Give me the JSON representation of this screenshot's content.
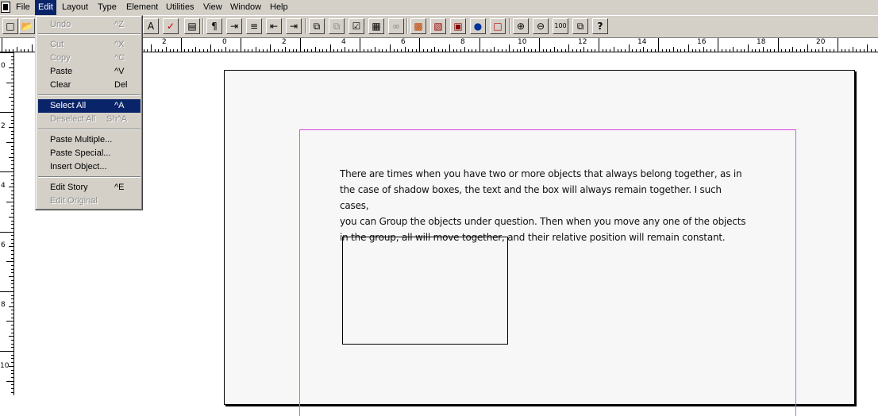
{
  "menubar": {
    "items": [
      {
        "label": "File"
      },
      {
        "label": "Edit"
      },
      {
        "label": "Layout"
      },
      {
        "label": "Type"
      },
      {
        "label": "Element"
      },
      {
        "label": "Utilities"
      },
      {
        "label": "View"
      },
      {
        "label": "Window"
      },
      {
        "label": "Help"
      }
    ]
  },
  "edit_menu": {
    "undo": {
      "label": "Undo",
      "shortcut": "^Z"
    },
    "cut": {
      "label": "Cut",
      "shortcut": "^X"
    },
    "copy": {
      "label": "Copy",
      "shortcut": "^C"
    },
    "paste": {
      "label": "Paste",
      "shortcut": "^V"
    },
    "clear": {
      "label": "Clear",
      "shortcut": "Del"
    },
    "select_all": {
      "label": "Select All",
      "shortcut": "^A"
    },
    "deselect_all": {
      "label": "Deselect All",
      "shortcut": "Sh^A"
    },
    "paste_multiple": {
      "label": "Paste Multiple..."
    },
    "paste_special": {
      "label": "Paste Special..."
    },
    "insert_object": {
      "label": "Insert Object..."
    },
    "edit_story": {
      "label": "Edit Story",
      "shortcut": "^E"
    },
    "edit_original": {
      "label": "Edit Original"
    }
  },
  "toolbar": {
    "zoom_label": "100",
    "help_label": "?"
  },
  "ruler": {
    "h_labels": [
      "2",
      "0",
      "2",
      "4",
      "6",
      "8",
      "10",
      "12",
      "14",
      "16",
      "18",
      "20"
    ],
    "v_labels": [
      "0",
      "2",
      "4",
      "6",
      "8",
      "10"
    ]
  },
  "document": {
    "paragraph": "There are times when you have two or more objects that always belong together,  as in\nthe case of shadow boxes, the text and the box will always remain together. I  such cases,\nyou can Group the objects under question. Then when you move any one of the objects\nin the group,  all will move together,  and their relative position will remain constant."
  }
}
